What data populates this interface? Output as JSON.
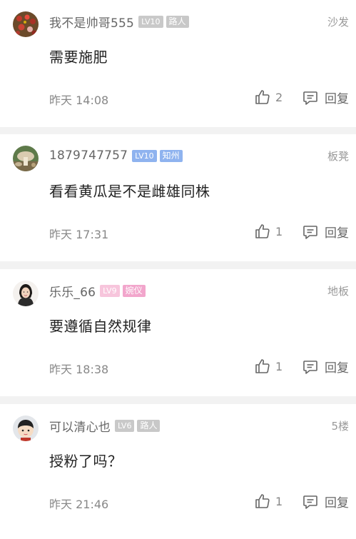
{
  "comments": [
    {
      "username": "我不是帅哥555",
      "level": "LV10",
      "title": "路人",
      "title_color": "#c8c8c8",
      "floor": "沙发",
      "text": "需要施肥",
      "time": "昨天 14:08",
      "likes": "2",
      "reply_label": "回复",
      "avatar": "red-berries-photo"
    },
    {
      "username": "1879747757",
      "level": "LV10",
      "title": "知州",
      "title_color": "#8fb3ef",
      "floor": "板凳",
      "text": "看看黄瓜是不是雌雄同株",
      "time": "昨天 17:31",
      "likes": "1",
      "reply_label": "回复",
      "avatar": "mushroom-photo"
    },
    {
      "username": "乐乐_66",
      "level": "LV9",
      "title": "婉仪",
      "title_color": "#f2a6cc",
      "floor": "地板",
      "text": "要遵循自然规律",
      "time": "昨天 18:38",
      "likes": "1",
      "reply_label": "回复",
      "avatar": "woman-portrait"
    },
    {
      "username": "可以清心也",
      "level": "LV6",
      "title": "路人",
      "title_color": "#c8c8c8",
      "floor": "5楼",
      "text": "授粉了吗？",
      "time": "昨天 21:46",
      "likes": "1",
      "reply_label": "回复",
      "avatar": "cartoon-boy"
    }
  ]
}
